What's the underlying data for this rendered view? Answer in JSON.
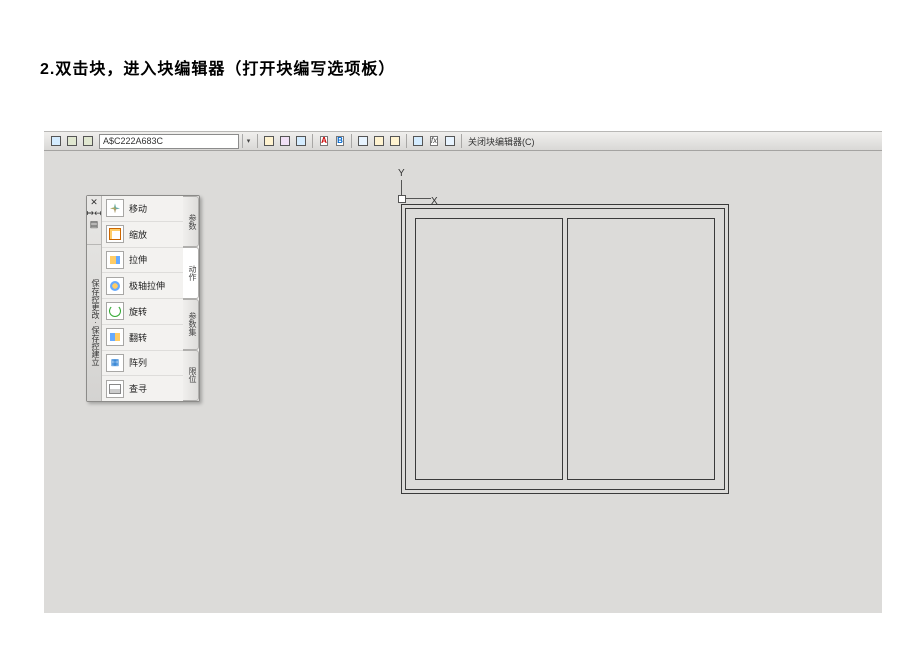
{
  "title": "2.双击块，进入块编辑器（打开块编写选项板）",
  "toolbar": {
    "block_name": "A$C222A683C",
    "a_label": "A",
    "b_label": "B",
    "fx_label": "fx",
    "close_label": "关闭块编辑器(C)"
  },
  "palette": {
    "ctrl_close": "✕",
    "ctrl_h": "↦↤",
    "ctrl_v": "▤",
    "side_text": "保存控更改 · 保存控建立",
    "items": [
      {
        "label": "移动"
      },
      {
        "label": "缩放"
      },
      {
        "label": "拉伸"
      },
      {
        "label": "极轴拉伸"
      },
      {
        "label": "旋转"
      },
      {
        "label": "翻转"
      },
      {
        "label": "阵列"
      },
      {
        "label": "查寻"
      }
    ],
    "tabs": [
      {
        "label": "参数"
      },
      {
        "label": "动作"
      },
      {
        "label": "参数集"
      },
      {
        "label": "限位"
      }
    ]
  },
  "axes": {
    "x": "X",
    "y": "Y"
  }
}
